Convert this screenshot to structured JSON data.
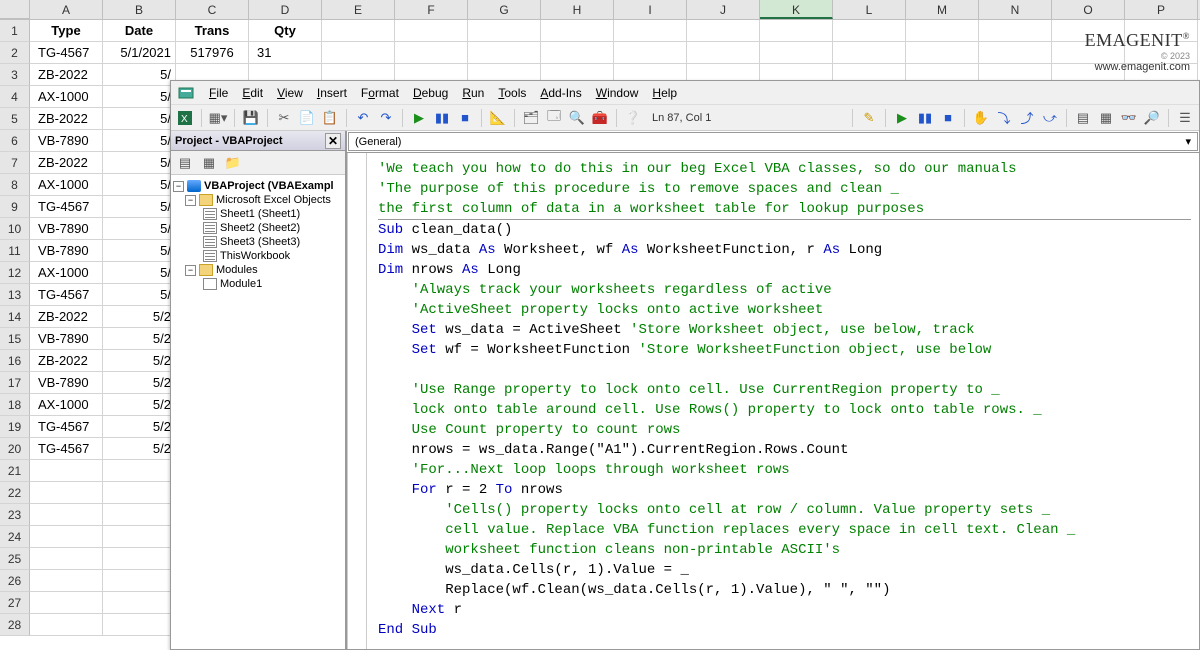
{
  "columns": [
    "A",
    "B",
    "C",
    "D",
    "E",
    "F",
    "G",
    "H",
    "I",
    "J",
    "K",
    "L",
    "M",
    "N",
    "O",
    "P"
  ],
  "selected_col": "K",
  "row_count": 28,
  "headers": [
    "Type",
    "Date",
    "Trans",
    "Qty"
  ],
  "data_rows": [
    [
      "TG-4567",
      "5/1/2021",
      "517976",
      "31"
    ],
    [
      "ZB-2022",
      "5/",
      "",
      ""
    ],
    [
      "AX-1000",
      "5/",
      "",
      ""
    ],
    [
      "ZB-2022",
      "5/",
      "",
      ""
    ],
    [
      "VB-7890",
      "5/",
      "",
      ""
    ],
    [
      "ZB-2022",
      "5/",
      "",
      ""
    ],
    [
      "AX-1000",
      "5/",
      "",
      ""
    ],
    [
      "TG-4567",
      "5/",
      "",
      ""
    ],
    [
      "VB-7890",
      "5/",
      "",
      ""
    ],
    [
      "VB-7890",
      "5/",
      "",
      ""
    ],
    [
      "AX-1000",
      "5/",
      "",
      ""
    ],
    [
      "TG-4567",
      "5/",
      "",
      ""
    ],
    [
      "ZB-2022",
      "5/2",
      "",
      ""
    ],
    [
      "VB-7890",
      "5/2",
      "",
      ""
    ],
    [
      "ZB-2022",
      "5/2",
      "",
      ""
    ],
    [
      "VB-7890",
      "5/2",
      "",
      ""
    ],
    [
      "AX-1000",
      "5/2",
      "",
      ""
    ],
    [
      "TG-4567",
      "5/2",
      "",
      ""
    ],
    [
      "TG-4567",
      "5/2",
      "",
      ""
    ]
  ],
  "logo": {
    "brand": "EMAGENIT",
    "copy": "© 2023",
    "url": "www.emagenit.com"
  },
  "vbe": {
    "menus": [
      "File",
      "Edit",
      "View",
      "Insert",
      "Format",
      "Debug",
      "Run",
      "Tools",
      "Add-Ins",
      "Window",
      "Help"
    ],
    "menu_und": [
      "F",
      "E",
      "V",
      "I",
      "o",
      "D",
      "R",
      "T",
      "A",
      "W",
      "H"
    ],
    "cursor": "Ln 87, Col 1",
    "proj_title": "Project - VBAProject",
    "dd_left": "(General)",
    "tree": {
      "root": "VBAProject (VBAExampl",
      "folder1": "Microsoft Excel Objects",
      "sheets": [
        "Sheet1 (Sheet1)",
        "Sheet2 (Sheet2)",
        "Sheet3 (Sheet3)",
        "ThisWorkbook"
      ],
      "folder2": "Modules",
      "module": "Module1"
    },
    "code": {
      "l1": "'We teach you how to do this in our beg Excel VBA classes, so do our manuals",
      "l2": "'The purpose of this procedure is to remove spaces and clean _",
      "l3": "the first column of data in a worksheet table for lookup purposes",
      "l4a": "Sub",
      "l4b": " clean_data()",
      "l5a": "Dim",
      "l5b": " ws_data ",
      "l5c": "As",
      "l5d": " Worksheet, wf ",
      "l5e": "As",
      "l5f": " WorksheetFunction, r ",
      "l5g": "As",
      "l5h": " Long",
      "l6a": "Dim",
      "l6b": " nrows ",
      "l6c": "As",
      "l6d": " Long",
      "l7": "    'Always track your worksheets regardless of active",
      "l8": "    'ActiveSheet property locks onto active worksheet",
      "l9a": "    Set",
      "l9b": " ws_data = ActiveSheet ",
      "l9c": "'Store Worksheet object, use below, track",
      "l10a": "    Set",
      "l10b": " wf = WorksheetFunction ",
      "l10c": "'Store WorksheetFunction object, use below",
      "l11": "",
      "l12": "    'Use Range property to lock onto cell. Use CurrentRegion property to _",
      "l13": "    lock onto table around cell. Use Rows() property to lock onto table rows. _",
      "l14": "    Use Count property to count rows",
      "l15": "    nrows = ws_data.Range(\"A1\").CurrentRegion.Rows.Count",
      "l16": "    'For...Next loop loops through worksheet rows",
      "l17a": "    For",
      "l17b": " r = 2 ",
      "l17c": "To",
      "l17d": " nrows",
      "l18": "        'Cells() property locks onto cell at row / column. Value property sets _",
      "l19": "        cell value. Replace VBA function replaces every space in cell text. Clean _",
      "l20": "        worksheet function cleans non-printable ASCII's",
      "l21": "        ws_data.Cells(r, 1).Value = _",
      "l22": "        Replace(wf.Clean(ws_data.Cells(r, 1).Value), \" \", \"\")",
      "l23a": "    Next",
      "l23b": " r",
      "l24": "End Sub"
    }
  }
}
